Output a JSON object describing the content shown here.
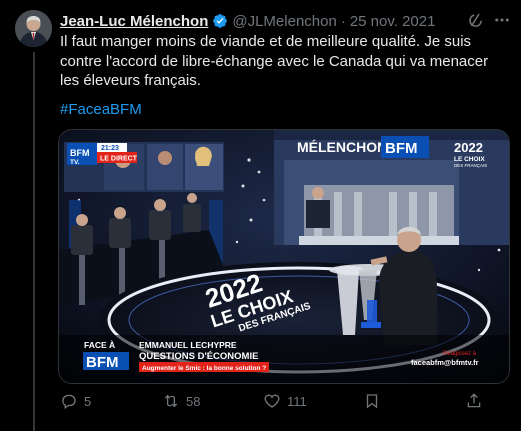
{
  "tweet": {
    "author_name": "Jean-Luc Mélenchon",
    "handle": "@JLMelenchon",
    "separator": "·",
    "date": "25 nov. 2021",
    "text": "Il faut manger moins de viande et de meilleure qualité. Je suis contre l'accord de libre-échange avec le Canada qui va menacer les éleveurs français.",
    "hashtag": "#FaceaBFM"
  },
  "media": {
    "bfm_logo": "BFM",
    "bfm_tv": "TV.",
    "time": "21:23",
    "live": "LE DIRECT",
    "screen_name": "MÉLENCHON",
    "screen_bfm": "BFM",
    "badge_year": "2022",
    "badge_text": "LE CHOIX",
    "badge_sub": "DES FRANÇAIS",
    "floor_year": "2022",
    "floor_text1": "LE CHOIX",
    "floor_text2": "DES FRANÇAIS",
    "face_a": "FACE À",
    "lower_bfm": "BFM",
    "speaker": "EMMANUEL LECHYPRE",
    "topic": "QUESTIONS D'ÉCONOMIE",
    "subtopic": "Augmenter le Smic : la bonne solution ?",
    "reagissez": "Réagissez à",
    "email": "faceabfm@bfmtv.fr"
  },
  "actions": {
    "replies": "5",
    "retweets": "58",
    "likes": "111"
  },
  "colors": {
    "accent": "#1d9bf0",
    "muted": "#71767b",
    "bfm_blue": "#0a4fb3",
    "live_red": "#e2231a"
  }
}
